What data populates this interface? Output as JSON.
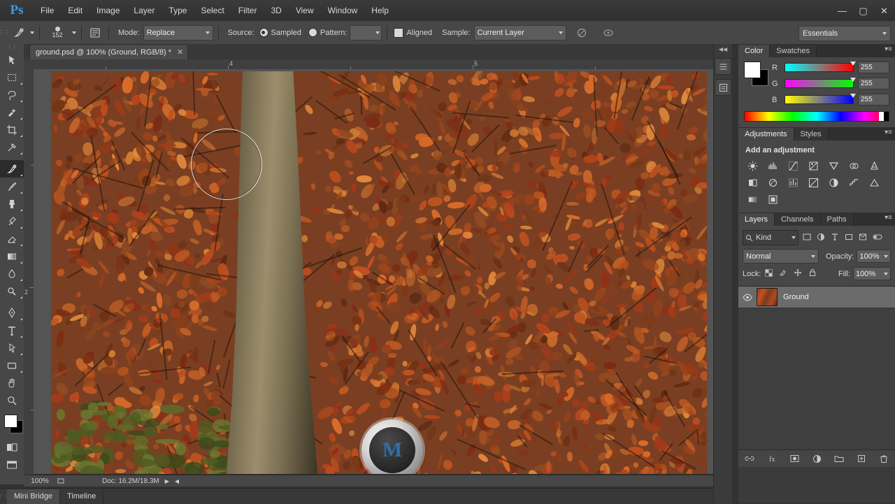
{
  "app": {
    "logo": "Ps",
    "menu": [
      "File",
      "Edit",
      "Image",
      "Layer",
      "Type",
      "Select",
      "Filter",
      "3D",
      "View",
      "Window",
      "Help"
    ],
    "window_buttons": {
      "minimize": "—",
      "maximize": "▢",
      "close": "✕"
    }
  },
  "options_bar": {
    "brush_size": "152",
    "mode_label": "Mode:",
    "mode_value": "Replace",
    "source_label": "Source:",
    "source_sampled": "Sampled",
    "source_pattern": "Pattern:",
    "aligned_label": "Aligned",
    "sample_label": "Sample:",
    "sample_value": "Current Layer",
    "workspace": "Essentials"
  },
  "document": {
    "tab_title": "ground.psd @ 100% (Ground, RGB/8) *",
    "close_glyph": "✕",
    "ruler_h_labels": [
      "4",
      "5"
    ],
    "ruler_v_labels": [
      "2"
    ]
  },
  "status_bar": {
    "zoom": "100%",
    "doc_info": "Doc: 16.2M/18.3M"
  },
  "bottom_tabs": [
    {
      "label": "Mini Bridge",
      "active": true
    },
    {
      "label": "Timeline",
      "active": false
    }
  ],
  "color_panel": {
    "tabs": [
      {
        "label": "Color",
        "active": true
      },
      {
        "label": "Swatches",
        "active": false
      }
    ],
    "channels": [
      {
        "name": "R",
        "value": "255"
      },
      {
        "name": "G",
        "value": "255"
      },
      {
        "name": "B",
        "value": "255"
      }
    ],
    "foreground": "#ffffff",
    "background": "#000000"
  },
  "adjustments_panel": {
    "tabs": [
      {
        "label": "Adjustments",
        "active": true
      },
      {
        "label": "Styles",
        "active": false
      }
    ],
    "heading": "Add an adjustment",
    "icons": [
      "brightness-contrast-icon",
      "levels-icon",
      "curves-icon",
      "exposure-icon",
      "vibrance-icon",
      "hue-saturation-icon",
      "color-balance-icon",
      "black-white-icon",
      "photo-filter-icon",
      "channel-mixer-icon",
      "color-lookup-icon",
      "invert-icon",
      "posterize-icon",
      "threshold-icon",
      "gradient-map-icon",
      "selective-color-icon"
    ]
  },
  "layers_panel": {
    "tabs": [
      {
        "label": "Layers",
        "active": true
      },
      {
        "label": "Channels",
        "active": false
      },
      {
        "label": "Paths",
        "active": false
      }
    ],
    "filter_label": "Kind",
    "blend_mode": "Normal",
    "opacity_label": "Opacity:",
    "opacity_value": "100%",
    "lock_label": "Lock:",
    "fill_label": "Fill:",
    "fill_value": "100%",
    "layers": [
      {
        "name": "Ground",
        "visible": true,
        "selected": true
      }
    ],
    "footer_icons": [
      "link-layers-icon",
      "layer-style-icon",
      "layer-mask-icon",
      "new-fill-adjustment-icon",
      "new-group-icon",
      "new-layer-icon",
      "delete-layer-icon"
    ]
  },
  "dock_icons": [
    "history-icon",
    "properties-icon"
  ],
  "tools": [
    {
      "name": "move-tool",
      "selected": false
    },
    {
      "name": "rectangular-marquee-tool",
      "selected": false
    },
    {
      "name": "lasso-tool",
      "selected": false
    },
    {
      "name": "quick-selection-tool",
      "selected": false
    },
    {
      "name": "crop-tool",
      "selected": false
    },
    {
      "name": "eyedropper-tool",
      "selected": false
    },
    {
      "name": "spot-healing-brush-tool",
      "selected": true
    },
    {
      "name": "brush-tool",
      "selected": false
    },
    {
      "name": "clone-stamp-tool",
      "selected": false
    },
    {
      "name": "history-brush-tool",
      "selected": false
    },
    {
      "name": "eraser-tool",
      "selected": false
    },
    {
      "name": "gradient-tool",
      "selected": false
    },
    {
      "name": "blur-tool",
      "selected": false
    },
    {
      "name": "dodge-tool",
      "selected": false
    },
    {
      "name": "pen-tool",
      "selected": false
    },
    {
      "name": "horizontal-type-tool",
      "selected": false
    },
    {
      "name": "path-selection-tool",
      "selected": false
    },
    {
      "name": "rectangle-tool",
      "selected": false
    },
    {
      "name": "hand-tool",
      "selected": false
    },
    {
      "name": "zoom-tool",
      "selected": false
    }
  ]
}
